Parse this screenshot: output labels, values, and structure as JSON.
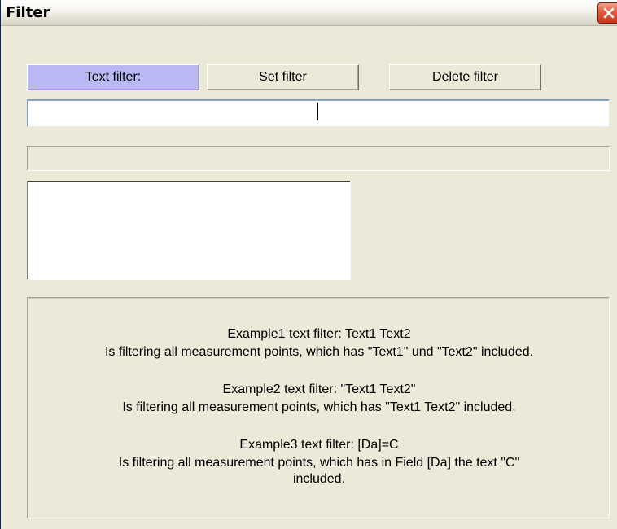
{
  "window": {
    "title": "Filter"
  },
  "toolbar": {
    "text_filter_label": "Text filter:",
    "set_filter_label": "Set filter",
    "delete_filter_label": "Delete filter"
  },
  "filter_input": {
    "value": "",
    "placeholder": ""
  },
  "status": {
    "text": ""
  },
  "help": {
    "example1_title": "Example1 text filter: Text1 Text2",
    "example1_desc": "Is filtering all measurement points, which has \"Text1\" und \"Text2\" included.",
    "example2_title": "Example2 text filter: \"Text1 Text2\"",
    "example2_desc": "Is filtering all measurement points, which has \"Text1 Text2\" included.",
    "example3_title": "Example3 text filter: [Da]=C",
    "example3_desc_line1": "Is filtering all measurement points, which has in Field [Da] the text \"C\"",
    "example3_desc_line2": "included."
  },
  "colors": {
    "dialog_background": "#ece9d8",
    "active_button": "#b8b8f5",
    "close_button": "#e05a38"
  },
  "icons": {
    "close": "close-icon"
  }
}
